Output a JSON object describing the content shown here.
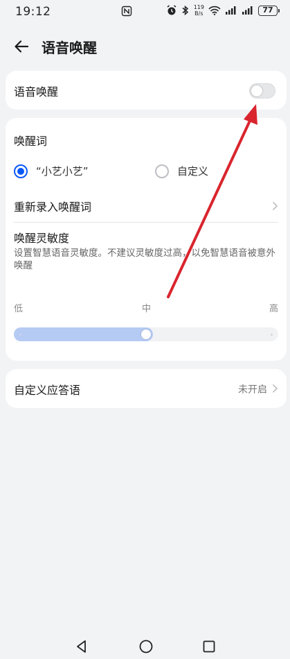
{
  "status": {
    "time": "19:12",
    "speed_top": "119",
    "speed_bottom": "B/s",
    "battery": "77"
  },
  "header": {
    "title": "语音唤醒",
    "back_icon": "back-arrow-icon"
  },
  "voice_wake": {
    "label": "语音唤醒",
    "enabled": false
  },
  "wake_word": {
    "title": "唤醒词",
    "options": [
      {
        "label": "“小艺小艺”",
        "selected": true
      },
      {
        "label": "自定义",
        "selected": false
      }
    ],
    "rerecord_label": "重新录入唤醒词"
  },
  "sensitivity": {
    "title": "唤醒灵敏度",
    "description": "设置智慧语音灵敏度。不建议灵敏度过高，以免智慧语音被意外唤醒",
    "labels": [
      "低",
      "中",
      "高"
    ],
    "level": 0.5
  },
  "custom_reply": {
    "label": "自定义应答语",
    "value": "未开启"
  },
  "colors": {
    "accent": "#0a59f7",
    "slider_fill": "#b6cbf4",
    "arrow": "#d9252e"
  }
}
